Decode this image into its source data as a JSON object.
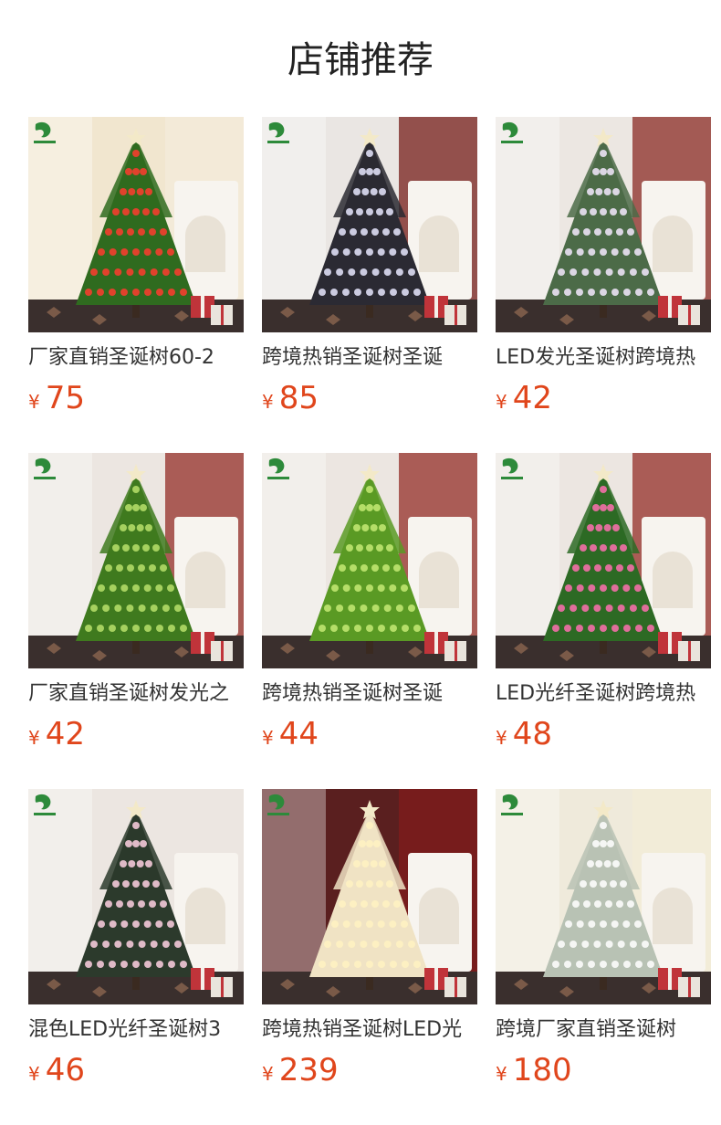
{
  "page": {
    "title": "店铺推荐"
  },
  "colors": {
    "price": "#e0461c",
    "title": "#222222",
    "text": "#333333"
  },
  "products": [
    {
      "name": "厂家直销圣诞树60-2",
      "currency": "¥",
      "price": "75",
      "image": "christmas-tree-red-ornaments",
      "tree_color": "#2f6b1f",
      "bg": "#f1e6cf",
      "wall": "#f3ead8",
      "lights": "#ff3b2f"
    },
    {
      "name": "跨境热销圣诞树圣诞",
      "currency": "¥",
      "price": "85",
      "image": "christmas-tree-fiber-optic-white",
      "tree_color": "#2b2a33",
      "bg": "#eae6e3",
      "wall": "#8a3f3b",
      "lights": "#e8e8ff"
    },
    {
      "name": "LED发光圣诞树跨境热",
      "currency": "¥",
      "price": "42",
      "image": "christmas-tree-led-mixed",
      "tree_color": "#4c6b48",
      "bg": "#ece7e2",
      "wall": "#9b4a45",
      "lights": "#f5e9ff"
    },
    {
      "name": "厂家直销圣诞树发光之",
      "currency": "¥",
      "price": "42",
      "image": "christmas-tree-green-fiber",
      "tree_color": "#3f7a1e",
      "bg": "#ece6e1",
      "wall": "#a34d47",
      "lights": "#b9e06b"
    },
    {
      "name": "跨境热销圣诞树圣诞",
      "currency": "¥",
      "price": "44",
      "image": "christmas-tree-bright-green",
      "tree_color": "#5a9a24",
      "bg": "#ece6e1",
      "wall": "#a34d47",
      "lights": "#c6ea74"
    },
    {
      "name": "LED光纤圣诞树跨境热",
      "currency": "¥",
      "price": "48",
      "image": "christmas-tree-colorful-led",
      "tree_color": "#2d6a24",
      "bg": "#ece6e1",
      "wall": "#a34d47",
      "lights": "#ff6fb0"
    },
    {
      "name": "混色LED光纤圣诞树3",
      "currency": "¥",
      "price": "46",
      "image": "christmas-tree-pink-white-fiber",
      "tree_color": "#2c3a2c",
      "bg": "#ece6e1",
      "wall": "#ece6e1",
      "lights": "#ffd1e3"
    },
    {
      "name": "跨境热销圣诞树LED光",
      "currency": "¥",
      "price": "239",
      "image": "christmas-tree-white-warm-lights",
      "tree_color": "#f0e3c4",
      "bg": "#5a1f1f",
      "wall": "#7a1c1c",
      "lights": "#fff2c2"
    },
    {
      "name": "跨境厂家直销圣诞树",
      "currency": "¥",
      "price": "180",
      "image": "christmas-tree-flocked-snow",
      "tree_color": "#b8c2b4",
      "bg": "#efeadb",
      "wall": "#f2ecd7",
      "lights": "#ffffff"
    }
  ]
}
